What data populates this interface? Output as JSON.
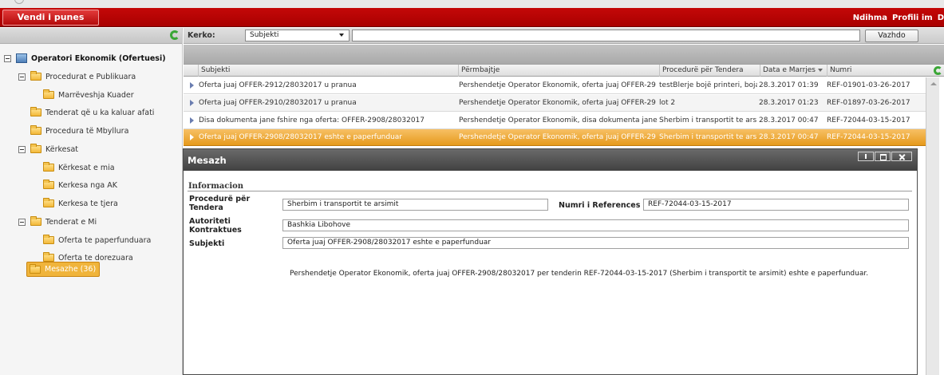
{
  "topbar": {
    "home_label": "Vendi i punes",
    "links": [
      "Ndihma",
      "Profili im",
      "D"
    ]
  },
  "tree": {
    "root": "Operatori Ekonomik (Ofertuesi)",
    "items": [
      {
        "label": "Procedurat e Publikuara"
      },
      {
        "label": "Marrëveshja Kuader"
      },
      {
        "label": "Tenderat që u ka kaluar afati"
      },
      {
        "label": "Procedura të Mbyllura"
      },
      {
        "label": "Kërkesat"
      },
      {
        "label": "Kërkesat e mia"
      },
      {
        "label": "Kerkesa nga AK"
      },
      {
        "label": "Kerkesa te tjera"
      },
      {
        "label": "Tenderat e Mi"
      },
      {
        "label": "Oferta te paperfunduara"
      },
      {
        "label": "Oferta te dorezuara"
      },
      {
        "label": "Mesazhe (36)"
      }
    ]
  },
  "search": {
    "label": "Kerko:",
    "field": "Subjekti",
    "value": "",
    "button": "Vazhdo"
  },
  "grid": {
    "columns": [
      "Subjekti",
      "Përmbajtje",
      "Procedurë për Tendera",
      "Data e Marrjes",
      "Numri"
    ],
    "rows": [
      {
        "subject": "Oferta juaj OFFER-2912/28032017 u pranua",
        "content": "Pershendetje Operator Ekonomik, oferta juaj OFFER-29",
        "procedure": "testBlerje bojë printeri, boja",
        "date": "28.3.2017 01:39",
        "number": "REF-01901-03-26-2017"
      },
      {
        "subject": "Oferta juaj OFFER-2910/28032017 u pranua",
        "content": "Pershendetje Operator Ekonomik, oferta juaj OFFER-29",
        "procedure": "lot 2",
        "date": "28.3.2017 01:23",
        "number": "REF-01897-03-26-2017"
      },
      {
        "subject": "Disa dokumenta jane fshire nga oferta: OFFER-2908/28032017",
        "content": "Pershendetje Operator Ekonomik, disa dokumenta jane",
        "procedure": "Sherbim i transportit te ars",
        "date": "28.3.2017 00:47",
        "number": "REF-72044-03-15-2017"
      },
      {
        "subject": "Oferta juaj OFFER-2908/28032017 eshte e paperfunduar",
        "content": "Pershendetje Operator Ekonomik, oferta juaj OFFER-29",
        "procedure": "Sherbim i transportit te ars",
        "date": "28.3.2017 00:47",
        "number": "REF-72044-03-15-2017"
      }
    ]
  },
  "modal": {
    "title": "Mesazh",
    "section": "Informacion",
    "procedure_label": "Procedurë për Tendera",
    "procedure_value": "Sherbim i transportit te arsimit",
    "reference_label": "Numri i References",
    "reference_value": "REF-72044-03-15-2017",
    "authority_label": "Autoriteti Kontraktues",
    "authority_value": "Bashkia Libohove",
    "subject_label": "Subjekti",
    "subject_value": "Oferta juaj OFFER-2908/28032017 eshte e paperfunduar",
    "body": "Pershendetje Operator Ekonomik, oferta juaj OFFER-2908/28032017 per tenderin REF-72044-03-15-2017 (Sherbim i transportit te arsimit) eshte e paperfunduar."
  }
}
